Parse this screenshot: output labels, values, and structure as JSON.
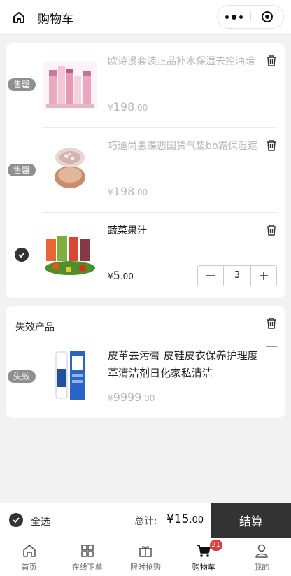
{
  "header": {
    "title": "购物车"
  },
  "cart_items": [
    {
      "name": "欧诗漫套装正品补水保湿去控油暗",
      "price_main": "198",
      "price_dec": ".00",
      "badge": "售罄"
    },
    {
      "name": "巧迪尚惠蝶恋国货气垫bb霜保湿遮",
      "price_main": "198",
      "price_dec": ".00",
      "badge": "售罄"
    },
    {
      "name": "蔬菜果汁",
      "price_main": "5",
      "price_dec": ".00",
      "quantity": "3"
    }
  ],
  "currency": "¥",
  "invalid_section": {
    "title": "失效产品",
    "item": {
      "name_line1": "皮革去污膏 皮鞋皮衣保养护理度",
      "name_line2": "革清洁剂日化家私清洁",
      "price_main": "9999",
      "price_dec": ".00",
      "badge": "失效"
    }
  },
  "footer": {
    "select_all": "全选",
    "total_label": "总计:",
    "total_main": "15",
    "total_dec": ".00",
    "checkout": "结算"
  },
  "tabbar": [
    {
      "label": "首页",
      "icon": "home-icon"
    },
    {
      "label": "在线下单",
      "icon": "grid-icon"
    },
    {
      "label": "限时抢购",
      "icon": "gift-icon"
    },
    {
      "label": "购物车",
      "icon": "cart-icon",
      "badge": "21"
    },
    {
      "label": "我的",
      "icon": "user-icon"
    }
  ],
  "colors": {
    "accent": "#333333",
    "badge_red": "#e23a3a",
    "sold_out_badge": "#8f8f8f"
  }
}
